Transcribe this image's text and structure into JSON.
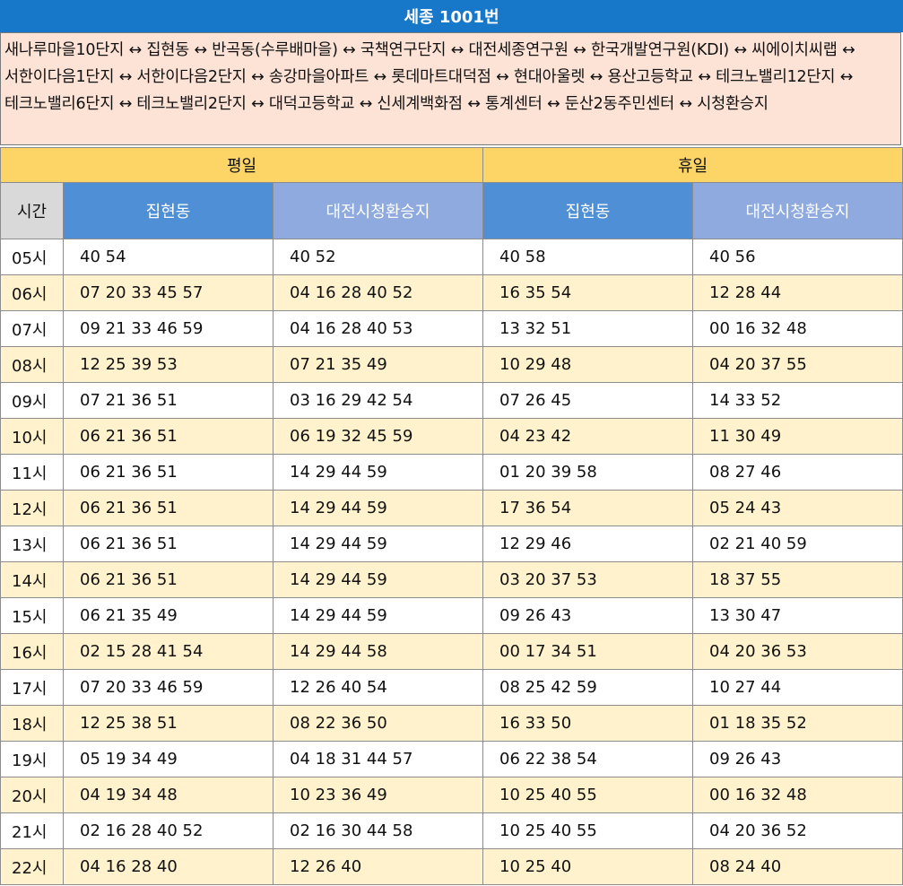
{
  "title": "세종 1001번",
  "route": "새나루마을10단지 ↔ 집현동 ↔ 반곡동(수루배마을) ↔ 국책연구단지 ↔ 대전세종연구원 ↔ 한국개발연구원(KDI) ↔ 씨에이치씨랩 ↔ 서한이다음1단지 ↔ 서한이다음2단지 ↔ 송강마을아파트 ↔ 롯데마트대덕점 ↔ 현대아울렛 ↔ 용산고등학교 ↔ 테크노밸리12단지 ↔ 테크노밸리6단지 ↔ 테크노밸리2단지 ↔ 대덕고등학교 ↔ 신세계백화점 ↔ 통계센터 ↔ 둔산2동주민센터 ↔ 시청환승지",
  "groups": {
    "weekday": "평일",
    "holiday": "휴일"
  },
  "headers": {
    "time": "시간",
    "weekday_a": "집현동",
    "weekday_b": "대전시청환승지",
    "holiday_a": "집현동",
    "holiday_b": "대전시청환승지"
  },
  "rows": [
    [
      "05시",
      "40 54",
      "40 52",
      "40 58",
      "40 56"
    ],
    [
      "06시",
      "07 20 33 45 57",
      "04 16 28 40 52",
      "16 35 54",
      "12 28 44"
    ],
    [
      "07시",
      "09 21 33 46 59",
      "04 16 28 40 53",
      "13 32 51",
      "00 16 32 48"
    ],
    [
      "08시",
      "12 25 39 53",
      "07 21 35 49",
      "10 29 48",
      "04 20 37 55"
    ],
    [
      "09시",
      "07 21 36 51",
      "03 16 29 42 54",
      "07 26 45",
      "14 33 52"
    ],
    [
      "10시",
      "06 21 36 51",
      "06 19 32 45 59",
      "04 23 42",
      "11 30 49"
    ],
    [
      "11시",
      "06 21 36 51",
      "14 29 44 59",
      "01 20 39 58",
      "08 27 46"
    ],
    [
      "12시",
      "06 21 36 51",
      "14 29 44 59",
      "17 36 54",
      "05 24 43"
    ],
    [
      "13시",
      "06 21 36 51",
      "14 29 44 59",
      "12 29 46",
      "02 21 40 59"
    ],
    [
      "14시",
      "06 21 36 51",
      "14 29 44 59",
      "03 20 37 53",
      "18 37 55"
    ],
    [
      "15시",
      "06 21 35 49",
      "14 29 44 59",
      "09 26 43",
      "13 30 47"
    ],
    [
      "16시",
      "02 15 28 41 54",
      "14 29 44 58",
      "00 17 34 51",
      "04 20 36 53"
    ],
    [
      "17시",
      "07 20 33 46 59",
      "12 26 40 54",
      "08 25 42 59",
      "10 27 44"
    ],
    [
      "18시",
      "12 25 38 51",
      "08 22 36 50",
      "16 33 50",
      "01 18 35 52"
    ],
    [
      "19시",
      "05 19 34 49",
      "04 18 31 44 57",
      "06 22 38 54",
      "09 26 43"
    ],
    [
      "20시",
      "04 19 34 48",
      "10 23 36 49",
      "10 25 40 55",
      "00 16 32 48"
    ],
    [
      "21시",
      "02 16 28 40 52",
      "02 16 30 44 58",
      "10 25 40 55",
      "04 20 36 52"
    ],
    [
      "22시",
      "04 16 28 40",
      "12 26 40",
      "10 25 40",
      "08 24 40"
    ]
  ],
  "colors": {
    "title_bg": "#1777c9",
    "route_bg": "#fde2d6",
    "group_bg": "#fdd466",
    "time_header_bg": "#d9d9d9",
    "col_a_header_bg": "#4e8fd6",
    "col_b_header_bg": "#8faadf",
    "alt_row_bg": "#fff2cc"
  }
}
